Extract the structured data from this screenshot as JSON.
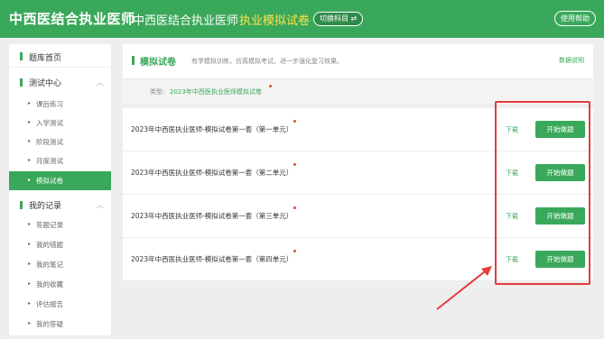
{
  "header": {
    "brand": "中西医结合执业医师",
    "subject": "中西医结合执业医师",
    "mode": "执业模拟试卷",
    "switch_label": "切换科目 ⇄",
    "help_label": "使用帮助"
  },
  "sidebar": {
    "home_label": "题库首页",
    "groups": [
      {
        "label": "测试中心",
        "items": [
          "课后练习",
          "入学测试",
          "阶段测试",
          "月度测试",
          "模拟试卷"
        ]
      },
      {
        "label": "我的记录",
        "items": [
          "答题记录",
          "我的错题",
          "我的笔记",
          "我的收藏",
          "评估报告",
          "我的答疑"
        ]
      }
    ],
    "active_item": "模拟试卷"
  },
  "panel": {
    "title": "模拟试卷",
    "description": "有学模拟训练，仿真模拟考试，进一步强化复习效果。",
    "link": "数据说明",
    "type_label": "类型:",
    "type_value": "2023年中西医执业医师模拟试卷"
  },
  "exams": [
    {
      "title": "2023年中西医执业医师-模拟试卷第一套（第一单元）",
      "download": "下载",
      "start": "开始做题"
    },
    {
      "title": "2023年中西医执业医师-模拟试卷第一套（第二单元）",
      "download": "下载",
      "start": "开始做题"
    },
    {
      "title": "2023年中西医执业医师-模拟试卷第一套（第三单元）",
      "download": "下载",
      "start": "开始做题"
    },
    {
      "title": "2023年中西医执业医师-模拟试卷第一套（第四单元）",
      "download": "下载",
      "start": "开始做题"
    }
  ],
  "colors": {
    "brand_green": "#3aa85a",
    "accent_yellow": "#ffe24a",
    "annotation_red": "#e53b3b",
    "new_dot": "#e64a3b"
  },
  "icons": {
    "chevron": "chevron-up-icon",
    "bullet": "triangle-right-icon"
  }
}
